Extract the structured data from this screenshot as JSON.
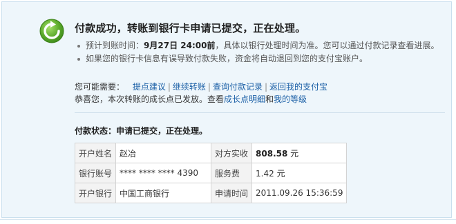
{
  "headline": "付款成功，转账到银行卡申请已提交，正在处理。",
  "notes": {
    "eta_prefix": "预计到账时间：",
    "eta_value": "9月27日  24:00前",
    "eta_suffix": "，具体以银行处理时间为准。您可以通过付款记录查看进展。",
    "error_note": "如果您的银行卡信息有误导致付款失败，资金将自动退回到您的支付宝账户。"
  },
  "needs": {
    "lead": "您可能需要：",
    "links": [
      "提点建议",
      "继续转账",
      "查询付款记录",
      "返回我的支付宝"
    ],
    "separator": "|"
  },
  "growth": {
    "text_before": "恭喜您，本次转账的成长点已发放。查看",
    "link_detail": "成长点明细",
    "text_and": "和",
    "link_level": "我的等级"
  },
  "status_label": "付款状态：申请已提交，正在处理。",
  "table": {
    "rows": [
      {
        "label1": "开户姓名",
        "value1": "赵冶",
        "label2": "对方实收",
        "value2_amount": "808.58",
        "value2_unit": " 元"
      },
      {
        "label1": "银行账号",
        "value1": "**** **** **** 4390",
        "label2": "服务费",
        "value2": "1.42 元"
      },
      {
        "label1": "开户银行",
        "value1": "中国工商银行",
        "label2": "申请时间",
        "value2": "2011.09.26 15:36:59"
      }
    ]
  },
  "colors": {
    "panel_bg": "#eef6fb",
    "link": "#1a5fa6",
    "icon_green": "#5aa92a"
  },
  "icons": {
    "success": "refresh-check-icon"
  }
}
